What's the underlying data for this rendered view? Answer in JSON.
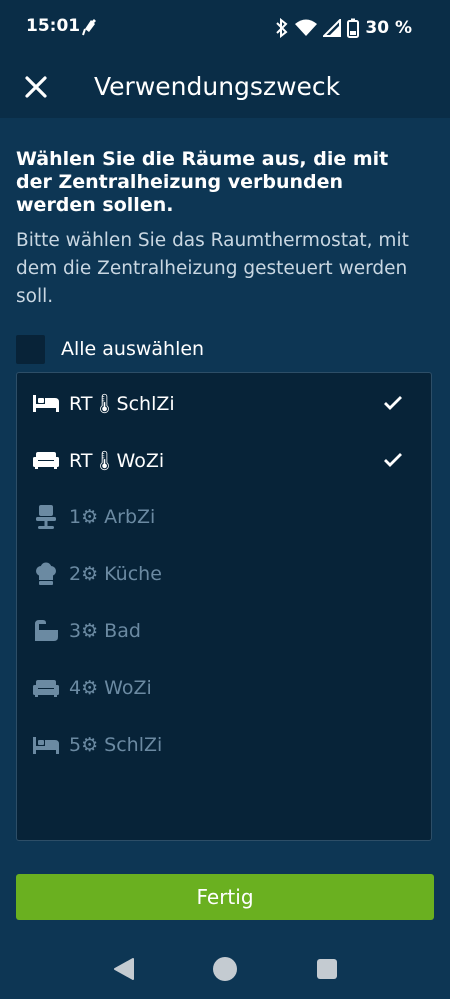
{
  "status_bar": {
    "time": "15:01",
    "battery": "30 %"
  },
  "app_bar": {
    "title": "Verwendungszweck"
  },
  "content": {
    "heading": "Wählen Sie die Räume aus, die mit der Zentralheizung verbunden werden sollen.",
    "subtext": "Bitte wählen Sie das Raumthermostat, mit dem die Zentralheizung gesteuert werden soll.",
    "select_all_label": "Alle auswählen"
  },
  "rooms": [
    {
      "label": "RT🌡SchlZi",
      "icon": "bed-icon",
      "state": "selected"
    },
    {
      "label": "RT🌡WoZi",
      "icon": "sofa-icon",
      "state": "selected"
    },
    {
      "label": "1⚙ ArbZi",
      "icon": "office-chair-icon",
      "state": "disabled"
    },
    {
      "label": "2⚙ Küche",
      "icon": "chef-hat-icon",
      "state": "disabled"
    },
    {
      "label": "3⚙ Bad",
      "icon": "bathtub-icon",
      "state": "disabled"
    },
    {
      "label": "4⚙ WoZi",
      "icon": "sofa-icon",
      "state": "disabled"
    },
    {
      "label": "5⚙ SchlZi",
      "icon": "bed-icon",
      "state": "disabled"
    }
  ],
  "footer": {
    "done_label": "Fertig"
  },
  "colors": {
    "background": "#0d3654",
    "list_background": "#072338",
    "accent_green": "#6ab020",
    "inactive_text": "#6b8aa2"
  }
}
